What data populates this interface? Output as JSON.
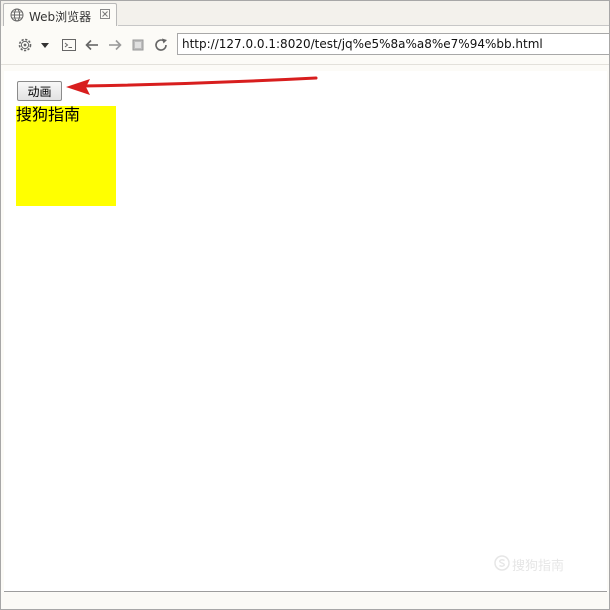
{
  "tab": {
    "title": "Web浏览器",
    "icon": "globe-icon",
    "close_icon": "close-icon"
  },
  "toolbar": {
    "icons": [
      "gear-icon",
      "dropdown-arrow-icon",
      "terminal-icon",
      "back-icon",
      "forward-icon",
      "stop-icon",
      "refresh-icon"
    ],
    "url": "http://127.0.0.1:8020/test/jq%e5%8a%a8%e7%94%bb.html"
  },
  "page": {
    "button_label": "动画",
    "box_text": "搜狗指南",
    "box_color": "#ffff00"
  },
  "annotation": {
    "arrow_color": "#d81e1e"
  },
  "watermark": {
    "text": "搜狗指南"
  }
}
